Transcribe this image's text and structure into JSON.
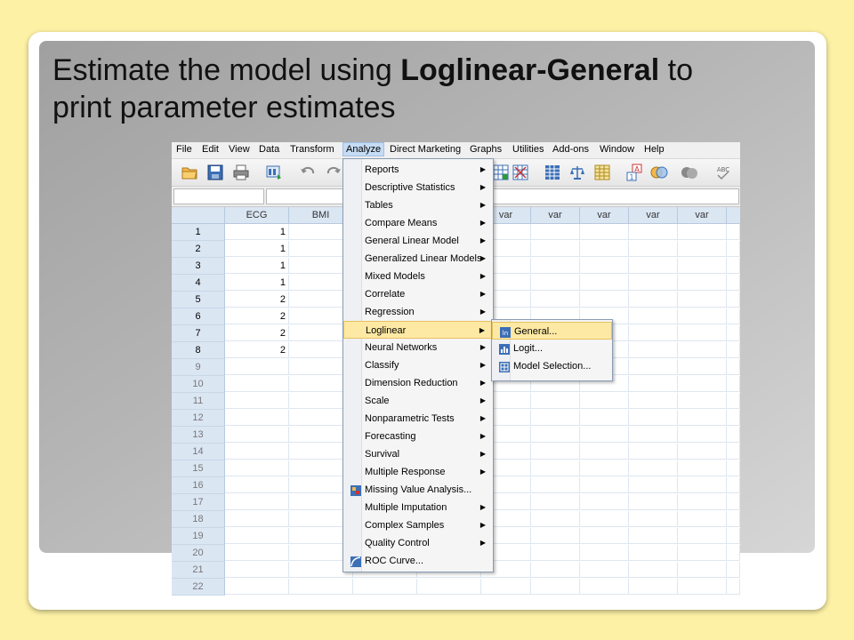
{
  "slide": {
    "title_prefix": "Estimate the model using ",
    "title_bold": "Loglinear-General",
    "title_suffix": " to",
    "title_line2": "print parameter estimates"
  },
  "menubar": [
    {
      "label": "File"
    },
    {
      "label": "Edit"
    },
    {
      "label": "View"
    },
    {
      "label": "Data"
    },
    {
      "label": "Transform"
    },
    {
      "label": "Analyze"
    },
    {
      "label": "Direct Marketing"
    },
    {
      "label": "Graphs"
    },
    {
      "label": "Utilities"
    },
    {
      "label": "Add-ons"
    },
    {
      "label": "Window"
    },
    {
      "label": "Help"
    }
  ],
  "grid": {
    "columns": [
      "ECG",
      "BMI",
      "var",
      "var",
      "var",
      "var",
      "var",
      "var",
      "var",
      "var"
    ],
    "rows": [
      "1",
      "2",
      "3",
      "4",
      "5",
      "6",
      "7",
      "8",
      "9",
      "10",
      "11",
      "12",
      "13",
      "14",
      "15",
      "16",
      "17",
      "18",
      "19",
      "20",
      "21",
      "22"
    ],
    "ecg_values": [
      "1",
      "1",
      "1",
      "1",
      "2",
      "2",
      "2",
      "2"
    ]
  },
  "analyze_menu": [
    {
      "label": "Reports",
      "submenu": true
    },
    {
      "label": "Descriptive Statistics",
      "submenu": true
    },
    {
      "label": "Tables",
      "submenu": true
    },
    {
      "label": "Compare Means",
      "submenu": true
    },
    {
      "label": "General Linear Model",
      "submenu": true
    },
    {
      "label": "Generalized Linear Models",
      "submenu": true
    },
    {
      "label": "Mixed Models",
      "submenu": true
    },
    {
      "label": "Correlate",
      "submenu": true
    },
    {
      "label": "Regression",
      "submenu": true
    },
    {
      "label": "Loglinear",
      "submenu": true,
      "highlighted": true
    },
    {
      "label": "Neural Networks",
      "submenu": true
    },
    {
      "label": "Classify",
      "submenu": true
    },
    {
      "label": "Dimension Reduction",
      "submenu": true
    },
    {
      "label": "Scale",
      "submenu": true
    },
    {
      "label": "Nonparametric Tests",
      "submenu": true
    },
    {
      "label": "Forecasting",
      "submenu": true
    },
    {
      "label": "Survival",
      "submenu": true
    },
    {
      "label": "Multiple Response",
      "submenu": true
    },
    {
      "label": "Missing Value Analysis...",
      "icon": "missing-value-icon"
    },
    {
      "label": "Multiple Imputation",
      "submenu": true
    },
    {
      "label": "Complex Samples",
      "submenu": true
    },
    {
      "label": "Quality Control",
      "submenu": true
    },
    {
      "label": "ROC Curve...",
      "icon": "roc-curve-icon"
    }
  ],
  "loglinear_submenu": [
    {
      "label": "General...",
      "highlighted": true,
      "icon": "general-icon"
    },
    {
      "label": "Logit...",
      "icon": "logit-icon"
    },
    {
      "label": "Model Selection...",
      "icon": "model-selection-icon"
    }
  ],
  "colors": {
    "slide_background": "#fdf1a6",
    "menu_highlight": "#fde9a4",
    "header_blue": "#dbe6f3"
  }
}
